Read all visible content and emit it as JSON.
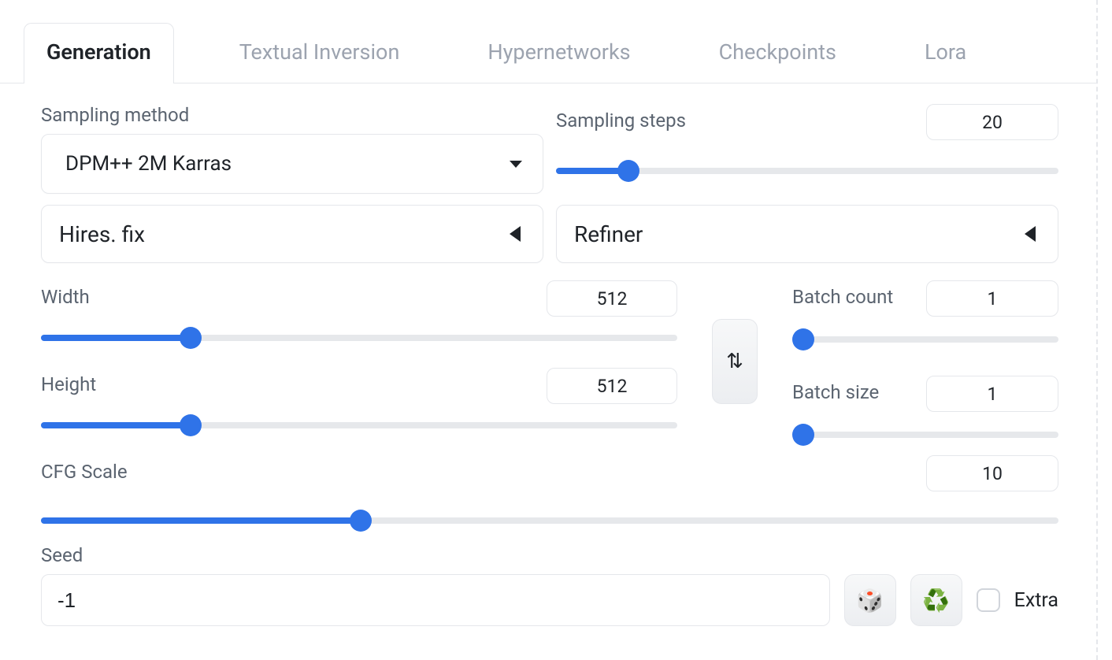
{
  "tabs": {
    "generation": "Generation",
    "textual_inversion": "Textual Inversion",
    "hypernetworks": "Hypernetworks",
    "checkpoints": "Checkpoints",
    "lora": "Lora"
  },
  "sampling": {
    "method_label": "Sampling method",
    "method_value": "DPM++ 2M Karras",
    "steps_label": "Sampling steps",
    "steps_value": "20",
    "steps_min": 1,
    "steps_max": 150,
    "steps_num": 20
  },
  "accordions": {
    "hires_label": "Hires. fix",
    "refiner_label": "Refiner"
  },
  "dims": {
    "width_label": "Width",
    "width_value": "512",
    "width_min": 64,
    "width_max": 2048,
    "width_num": 512,
    "height_label": "Height",
    "height_value": "512",
    "height_min": 64,
    "height_max": 2048,
    "height_num": 512
  },
  "batch": {
    "count_label": "Batch count",
    "count_value": "1",
    "count_min": 1,
    "count_max": 100,
    "count_num": 1,
    "size_label": "Batch size",
    "size_value": "1",
    "size_min": 1,
    "size_max": 8,
    "size_num": 1
  },
  "cfg": {
    "label": "CFG Scale",
    "value": "10",
    "min": 1,
    "max": 30,
    "num": 10
  },
  "seed": {
    "label": "Seed",
    "value": "-1",
    "extra_label": "Extra"
  },
  "icons": {
    "swap": "⇅",
    "dice": "🎲",
    "recycle": "♻️"
  }
}
